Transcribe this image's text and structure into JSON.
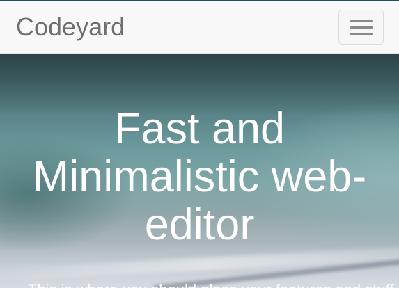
{
  "navbar": {
    "brand": "Codeyard",
    "toggle_icon": "hamburger-menu-icon"
  },
  "hero": {
    "title": "Fast and Minimalistic web-editor",
    "subtitle": "This is where you should place your features and stuff."
  },
  "colors": {
    "navbar_bg": "#f8f8f8",
    "brand_text": "#6f6f6f",
    "hero_text": "#ffffff",
    "hero_teal": "#6c9a9c"
  }
}
